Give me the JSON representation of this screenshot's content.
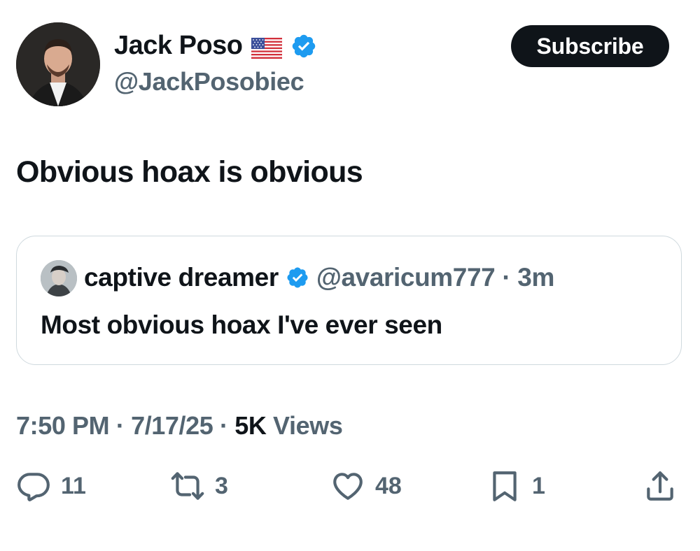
{
  "author": {
    "name": "Jack Poso",
    "flag": "🇺🇸",
    "handle": "@JackPosobiec",
    "verified": true
  },
  "subscribe_label": "Subscribe",
  "tweet_text": "Obvious hoax is obvious",
  "quoted": {
    "name": "captive dreamer",
    "handle": "@avaricum777",
    "separator": "·",
    "time": "3m",
    "text": "Most obvious hoax I've ever seen",
    "verified": true
  },
  "meta": {
    "time": "7:50 PM",
    "date": "7/17/25",
    "views_count": "5K",
    "views_label": "Views",
    "separator": "·"
  },
  "actions": {
    "replies": "11",
    "reposts": "3",
    "likes": "48",
    "bookmarks": "1"
  },
  "colors": {
    "text": "#0f1419",
    "secondary": "#536471",
    "verified_blue": "#1d9bf0",
    "border": "#cfd9de"
  },
  "icons": [
    "reply-icon",
    "repost-icon",
    "like-icon",
    "bookmark-icon",
    "share-icon",
    "verified-badge-icon"
  ]
}
